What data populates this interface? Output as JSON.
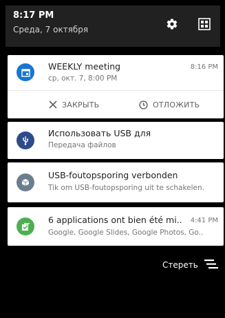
{
  "status": {
    "time": "8:17 PM",
    "date": "Среда, 7 октября",
    "settings_icon": "gear-icon",
    "quick_settings_icon": "quick-settings-icon"
  },
  "notifications": [
    {
      "app_icon": "calendar-icon",
      "icon_color": "#1976D2",
      "title": "WEEKLY meeting",
      "subtitle": "ср, окт. 7, 8:00 PM",
      "time": "8:16 PM",
      "actions": [
        {
          "label": "ЗАКРЫТЬ",
          "icon": "close-icon"
        },
        {
          "label": "ОТЛОЖИТЬ",
          "icon": "clock-icon"
        }
      ]
    },
    {
      "app_icon": "usb-icon",
      "icon_color": "#2E4A8A",
      "title": "Использовать USB для",
      "subtitle": "Передача файлов"
    },
    {
      "app_icon": "debug-icon",
      "icon_color": "#6A7F8E",
      "title": "USB-foutopsporing verbonden",
      "subtitle": "Tik om USB-foutopsporing uit te schakelen."
    },
    {
      "app_icon": "install-icon",
      "icon_color": "#4CAF50",
      "title": "6 applications ont bien été mi..",
      "subtitle": "Google, Google Slides, Google Photos, Go..",
      "time": "4:41 PM"
    }
  ],
  "clear_all": {
    "label": "Стереть",
    "icon": "clear-all-icon"
  }
}
